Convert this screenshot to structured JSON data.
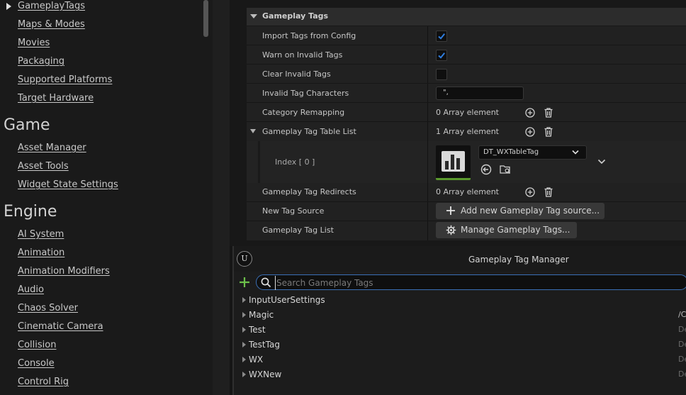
{
  "nav": {
    "items_top": [
      "GameplayTags",
      "Maps & Modes",
      "Movies",
      "Packaging",
      "Supported Platforms",
      "Target Hardware"
    ],
    "sections": [
      {
        "title": "Game",
        "items": [
          "Asset Manager",
          "Asset Tools",
          "Widget State Settings"
        ]
      },
      {
        "title": "Engine",
        "items": [
          "AI System",
          "Animation",
          "Animation Modifiers",
          "Audio",
          "Chaos Solver",
          "Cinematic Camera",
          "Collision",
          "Console",
          "Control Rig"
        ]
      }
    ]
  },
  "details": {
    "category": "Gameplay Tags",
    "import_tags": {
      "label": "Import Tags from Config",
      "checked": true
    },
    "warn_invalid": {
      "label": "Warn on Invalid Tags",
      "checked": true
    },
    "clear_invalid": {
      "label": "Clear Invalid Tags",
      "checked": false
    },
    "invalid_chars": {
      "label": "Invalid Tag Characters",
      "value": "\",",
      "placeholder": ""
    },
    "category_remapping": {
      "label": "Category Remapping",
      "count": "0 Array element"
    },
    "table_list": {
      "label": "Gameplay Tag Table List",
      "count": "1 Array element",
      "index_label": "Index [ 0 ]",
      "asset": "DT_WXTableTag"
    },
    "redirects": {
      "label": "Gameplay Tag Redirects",
      "count": "0 Array element"
    },
    "new_tag_source": {
      "label": "New Tag Source",
      "button": "Add new Gameplay Tag source..."
    },
    "tag_list": {
      "label": "Gameplay Tag List",
      "button": "Manage Gameplay Tags..."
    }
  },
  "tag_manager": {
    "title": "Gameplay Tag Manager",
    "search_placeholder": "Search Gameplay Tags",
    "search_value": "",
    "tags": [
      {
        "name": "InputUserSettings",
        "source": ""
      },
      {
        "name": "Magic",
        "source": "/C"
      },
      {
        "name": "Test",
        "source": "De"
      },
      {
        "name": "TestTag",
        "source": "De"
      },
      {
        "name": "WX",
        "source": "De"
      },
      {
        "name": "WXNew",
        "source": "De"
      }
    ]
  },
  "colors": {
    "accent_blue": "#3b6fb6",
    "add_green": "#6cc04a",
    "thumb_green": "#5b9a2d"
  }
}
